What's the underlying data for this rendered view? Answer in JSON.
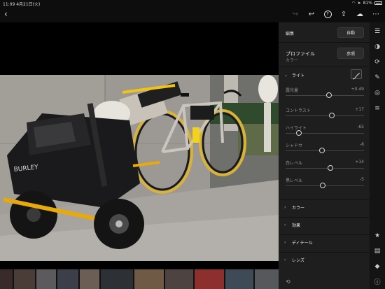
{
  "status": {
    "time": "11:09",
    "date": "4月21日(火)",
    "battery": "81%"
  },
  "toolbar": {
    "back_icon": "chevron-left-icon",
    "icons": [
      "redo-icon",
      "undo-icon",
      "help-icon",
      "share-icon",
      "cloud-sync-icon",
      "more-icon"
    ]
  },
  "panel": {
    "title": "編集",
    "auto_label": "自動",
    "profile_label": "プロファイル",
    "profile_value": "カラー",
    "browse_label": "参照",
    "light_section": "ライト",
    "sliders": [
      {
        "label": "露光量",
        "value": "+0.49",
        "position": 0.55
      },
      {
        "label": "コントラスト",
        "value": "+17",
        "position": 0.59
      },
      {
        "label": "ハイライト",
        "value": "-65",
        "position": 0.17
      },
      {
        "label": "シャドウ",
        "value": "-8",
        "position": 0.46
      },
      {
        "label": "白レベル",
        "value": "+14",
        "position": 0.57
      },
      {
        "label": "黒レベル",
        "value": "-5",
        "position": 0.47
      }
    ],
    "sections": [
      "カラー",
      "効果",
      "ディテール",
      "レンズ"
    ]
  },
  "colors": {
    "panel_bg": "#1e1e1e",
    "canvas_bg": "#000000",
    "accent": "#e8e8e8"
  }
}
